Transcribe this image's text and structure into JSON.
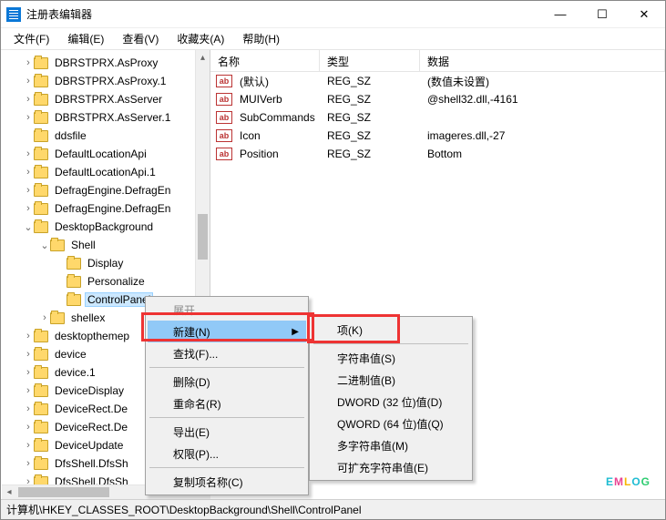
{
  "title": "注册表编辑器",
  "window_controls": {
    "min": "—",
    "max": "☐",
    "close": "✕"
  },
  "menubar": [
    "文件(F)",
    "编辑(E)",
    "查看(V)",
    "收藏夹(A)",
    "帮助(H)"
  ],
  "tree": [
    {
      "indent": 0,
      "twist": ">",
      "label": "DBRSTPRX.AsProxy"
    },
    {
      "indent": 0,
      "twist": ">",
      "label": "DBRSTPRX.AsProxy.1"
    },
    {
      "indent": 0,
      "twist": ">",
      "label": "DBRSTPRX.AsServer"
    },
    {
      "indent": 0,
      "twist": ">",
      "label": "DBRSTPRX.AsServer.1"
    },
    {
      "indent": 0,
      "twist": "",
      "label": "ddsfile"
    },
    {
      "indent": 0,
      "twist": ">",
      "label": "DefaultLocationApi"
    },
    {
      "indent": 0,
      "twist": ">",
      "label": "DefaultLocationApi.1"
    },
    {
      "indent": 0,
      "twist": ">",
      "label": "DefragEngine.DefragEn"
    },
    {
      "indent": 0,
      "twist": ">",
      "label": "DefragEngine.DefragEn"
    },
    {
      "indent": 0,
      "twist": "v",
      "label": "DesktopBackground"
    },
    {
      "indent": 1,
      "twist": "v",
      "label": "Shell"
    },
    {
      "indent": 2,
      "twist": "",
      "label": "Display"
    },
    {
      "indent": 2,
      "twist": "",
      "label": "Personalize"
    },
    {
      "indent": 2,
      "twist": "",
      "label": "ControlPanel",
      "selected": true
    },
    {
      "indent": 1,
      "twist": ">",
      "label": "shellex"
    },
    {
      "indent": 0,
      "twist": ">",
      "label": "desktopthemep"
    },
    {
      "indent": 0,
      "twist": ">",
      "label": "device"
    },
    {
      "indent": 0,
      "twist": ">",
      "label": "device.1"
    },
    {
      "indent": 0,
      "twist": ">",
      "label": "DeviceDisplay"
    },
    {
      "indent": 0,
      "twist": ">",
      "label": "DeviceRect.De"
    },
    {
      "indent": 0,
      "twist": ">",
      "label": "DeviceRect.De"
    },
    {
      "indent": 0,
      "twist": ">",
      "label": "DeviceUpdate"
    },
    {
      "indent": 0,
      "twist": ">",
      "label": "DfsShell.DfsSh"
    },
    {
      "indent": 0,
      "twist": ">",
      "label": "DfsShell.DfsSh"
    }
  ],
  "list_headers": {
    "name": "名称",
    "type": "类型",
    "data": "数据"
  },
  "values": [
    {
      "name": "(默认)",
      "type": "REG_SZ",
      "data": "(数值未设置)"
    },
    {
      "name": "MUIVerb",
      "type": "REG_SZ",
      "data": "@shell32.dll,-4161"
    },
    {
      "name": "SubCommands",
      "type": "REG_SZ",
      "data": ""
    },
    {
      "name": "Icon",
      "type": "REG_SZ",
      "data": "imageres.dll,-27"
    },
    {
      "name": "Position",
      "type": "REG_SZ",
      "data": "Bottom"
    }
  ],
  "context_menu_1": {
    "expand": "展开",
    "new": "新建(N)",
    "find": "查找(F)...",
    "delete": "删除(D)",
    "rename": "重命名(R)",
    "export": "导出(E)",
    "perms": "权限(P)...",
    "copy_key_name": "复制项名称(C)"
  },
  "context_menu_2": {
    "key": "项(K)",
    "string": "字符串值(S)",
    "binary": "二进制值(B)",
    "dword": "DWORD (32 位)值(D)",
    "qword": "QWORD (64 位)值(Q)",
    "multi": "多字符串值(M)",
    "expand": "可扩充字符串值(E)"
  },
  "statusbar": "计算机\\HKEY_CLASSES_ROOT\\DesktopBackground\\Shell\\ControlPanel",
  "watermark": "EMLOG"
}
